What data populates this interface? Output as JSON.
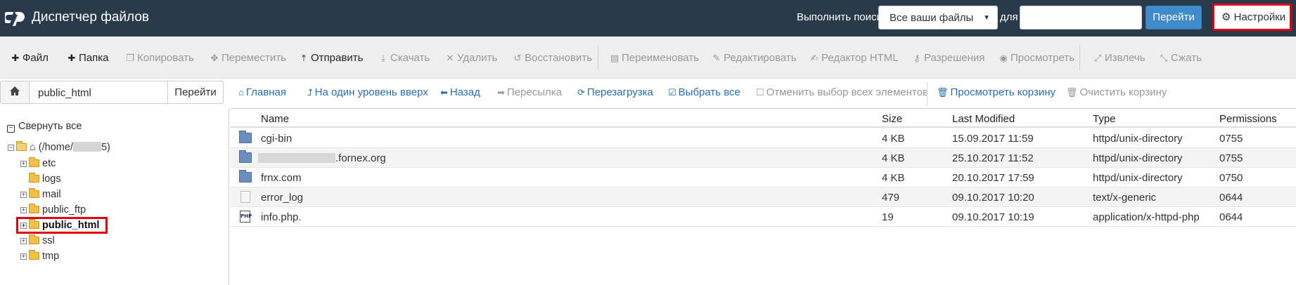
{
  "app": {
    "title": "Диспетчер файлов"
  },
  "search": {
    "label": "Выполнить поиск",
    "scope_value": "Все ваши файлы",
    "for_label": "для",
    "query_value": "",
    "go_label": "Перейти"
  },
  "settings": {
    "label": "Настройки"
  },
  "toolbar": {
    "items": [
      {
        "label": "Файл",
        "icon": "plus-icon",
        "enabled": true
      },
      {
        "label": "Папка",
        "icon": "plus-icon",
        "enabled": true
      },
      {
        "label": "Копировать",
        "icon": "copy-icon",
        "enabled": false
      },
      {
        "label": "Переместить",
        "icon": "move-icon",
        "enabled": false
      },
      {
        "label": "Отправить",
        "icon": "upload-icon",
        "enabled": true
      },
      {
        "label": "Скачать",
        "icon": "download-icon",
        "enabled": false
      },
      {
        "label": "Удалить",
        "icon": "times-icon",
        "enabled": false
      },
      {
        "label": "Восстановить",
        "icon": "undo-icon",
        "enabled": false
      },
      {
        "label": "Переименовать",
        "icon": "file-icon",
        "enabled": false
      },
      {
        "label": "Редактировать",
        "icon": "pencil-icon",
        "enabled": false
      },
      {
        "label": "Редактор HTML",
        "icon": "edit-icon",
        "enabled": false
      },
      {
        "label": "Разрешения",
        "icon": "key-icon",
        "enabled": false
      },
      {
        "label": "Просмотреть",
        "icon": "eye-icon",
        "enabled": false
      },
      {
        "label": "Извлечь",
        "icon": "expand-icon",
        "enabled": false
      },
      {
        "label": "Сжать",
        "icon": "compress-icon",
        "enabled": false
      }
    ]
  },
  "pathbar": {
    "path_value": "public_html",
    "go_label": "Перейти"
  },
  "nav": {
    "items": [
      {
        "label": "Главная",
        "icon": "home-icon",
        "enabled": true
      },
      {
        "label": "На один уровень вверх",
        "icon": "level-up-icon",
        "enabled": true
      },
      {
        "label": "Назад",
        "icon": "arrow-left-icon",
        "enabled": true
      },
      {
        "label": "Пересылка",
        "icon": "arrow-right-icon",
        "enabled": false
      },
      {
        "label": "Перезагрузка",
        "icon": "refresh-icon",
        "enabled": true
      },
      {
        "label": "Выбрать все",
        "icon": "check-square-icon",
        "enabled": true
      },
      {
        "label": "Отменить выбор всех элементов",
        "icon": "square-icon",
        "enabled": false
      },
      {
        "label": "Просмотреть корзину",
        "icon": "trash-icon",
        "enabled": true
      },
      {
        "label": "Очистить корзину",
        "icon": "trash-icon",
        "enabled": false
      }
    ]
  },
  "tree": {
    "collapse_all_label": "Свернуть все",
    "root_label_prefix": "(/home/",
    "root_label_suffix": "5)",
    "children": [
      {
        "label": "etc",
        "expandable": true,
        "selected": false
      },
      {
        "label": "logs",
        "expandable": false,
        "selected": false
      },
      {
        "label": "mail",
        "expandable": true,
        "selected": false
      },
      {
        "label": "public_ftp",
        "expandable": true,
        "selected": false
      },
      {
        "label": "public_html",
        "expandable": true,
        "selected": true
      },
      {
        "label": "ssl",
        "expandable": true,
        "selected": false
      },
      {
        "label": "tmp",
        "expandable": true,
        "selected": false
      }
    ]
  },
  "table": {
    "columns": [
      "Name",
      "Size",
      "Last Modified",
      "Type",
      "Permissions"
    ],
    "rows": [
      {
        "name": "cgi-bin",
        "icon": "folder-icon",
        "size": "4 KB",
        "modified": "15.09.2017 11:59",
        "type": "httpd/unix-directory",
        "perms": "0755"
      },
      {
        "name": ".fornex.org",
        "icon": "folder-icon",
        "size": "4 KB",
        "modified": "25.10.2017 11:52",
        "type": "httpd/unix-directory",
        "perms": "0755"
      },
      {
        "name": "frnx.com",
        "icon": "folder-icon",
        "size": "4 KB",
        "modified": "20.10.2017 17:59",
        "type": "httpd/unix-directory",
        "perms": "0750"
      },
      {
        "name": "error_log",
        "icon": "text-file-icon",
        "size": "479",
        "modified": "09.10.2017 10:20",
        "type": "text/x-generic",
        "perms": "0644"
      },
      {
        "name": "info.php.",
        "icon": "php-file-icon",
        "size": "19",
        "modified": "09.10.2017 10:19",
        "type": "application/x-httpd-php",
        "perms": "0644"
      }
    ]
  },
  "colors": {
    "topbar": "#293a4a",
    "primary_button": "#428bca",
    "link": "#2a6fb0",
    "highlight_border": "#e00010"
  }
}
